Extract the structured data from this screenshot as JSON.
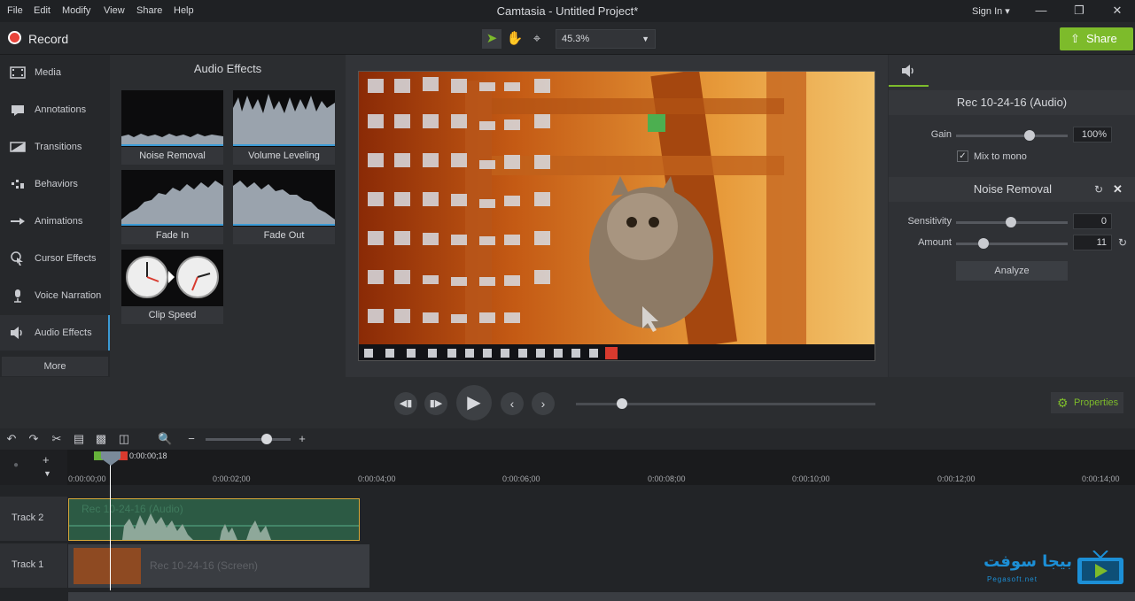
{
  "menu": [
    "File",
    "Edit",
    "Modify",
    "View",
    "Share",
    "Help"
  ],
  "app_title": "Camtasia - Untitled Project*",
  "sign_in": "Sign In ▾",
  "toolbar": {
    "record_label": "Record",
    "zoom": "45.3%",
    "share_label": "Share"
  },
  "nav": {
    "items": [
      {
        "label": "Media",
        "icon": "film-icon"
      },
      {
        "label": "Annotations",
        "icon": "callout-icon"
      },
      {
        "label": "Transitions",
        "icon": "transition-icon"
      },
      {
        "label": "Behaviors",
        "icon": "behavior-icon"
      },
      {
        "label": "Animations",
        "icon": "arrow-icon"
      },
      {
        "label": "Cursor Effects",
        "icon": "cursor-icon"
      },
      {
        "label": "Voice Narration",
        "icon": "microphone-icon"
      },
      {
        "label": "Audio Effects",
        "icon": "speaker-icon"
      }
    ],
    "more": "More"
  },
  "library": {
    "title": "Audio Effects",
    "tiles": [
      "Noise Removal",
      "Volume Leveling",
      "Fade In",
      "Fade Out",
      "Clip Speed"
    ]
  },
  "properties": {
    "clip_title": "Rec 10-24-16 (Audio)",
    "gain_label": "Gain",
    "gain_value": "100%",
    "gain_fraction": 0.66,
    "mix_mono": "Mix to mono",
    "noise_title": "Noise Removal",
    "sensitivity_label": "Sensitivity",
    "sensitivity_value": "0",
    "amount_label": "Amount",
    "amount_value": "11",
    "analyze": "Analyze",
    "button": "Properties"
  },
  "timeline": {
    "playhead_time": "0:00:00;18",
    "ticks": [
      "0:00:00;00",
      "0:00:02;00",
      "0:00:04;00",
      "0:00:06;00",
      "0:00:08;00",
      "0:00:10;00",
      "0:00:12;00",
      "0:00:14;00"
    ],
    "tracks": [
      {
        "name": "Track 2",
        "clip": "Rec 10-24-16 (Audio)"
      },
      {
        "name": "Track 1",
        "clip": "Rec 10-24-16 (Screen)"
      }
    ]
  },
  "colors": {
    "accent": "#7dbb2b",
    "record": "#e8443b",
    "selection": "#d8a83a"
  },
  "watermark": {
    "arabic": "بيجا سوفت",
    "latin": "Pegasoft.net"
  }
}
